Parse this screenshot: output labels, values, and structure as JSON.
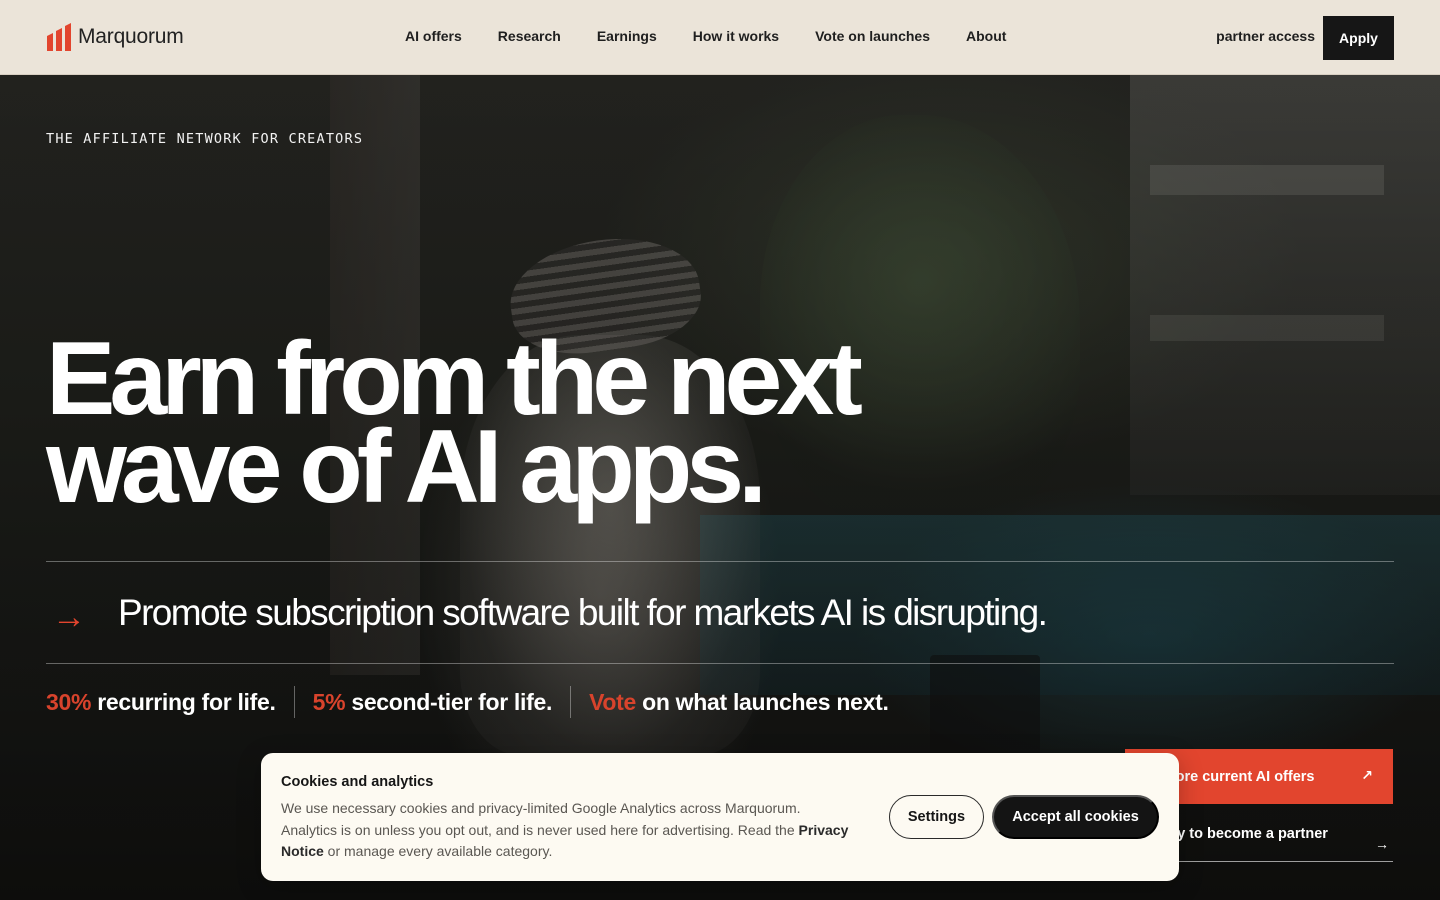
{
  "brand": {
    "name": "Marquorum",
    "accent_color": "#e2452e",
    "logo_icon": "bars-logo-icon"
  },
  "header": {
    "nav": [
      {
        "label": "AI offers"
      },
      {
        "label": "Research"
      },
      {
        "label": "Earnings"
      },
      {
        "label": "How it works"
      },
      {
        "label": "Vote on launches"
      },
      {
        "label": "About"
      }
    ],
    "partner_access": "partner access",
    "apply": "Apply"
  },
  "hero": {
    "eyebrow": "THE AFFILIATE NETWORK FOR CREATORS",
    "headline_line1": "Earn from the next",
    "headline_line2": "wave of AI apps.",
    "tagline_arrow": "→",
    "tagline": "Promote subscription software built for markets AI is disrupting.",
    "stats": [
      {
        "highlight": "30%",
        "text": " recurring for life."
      },
      {
        "highlight": "5%",
        "text": " second-tier for life."
      },
      {
        "highlight": "Vote",
        "text": " on what launches next."
      }
    ],
    "cta_primary": {
      "label": "Explore current AI offers",
      "arrow": "↗"
    },
    "cta_secondary": {
      "label": "Apply to become a partner",
      "arrow": "→"
    }
  },
  "cookie": {
    "title": "Cookies and analytics",
    "body_before": "We use necessary cookies and privacy-limited Google Analytics across Marquorum. Analytics is on unless you opt out, and is never used here for advertising. Read the ",
    "privacy_link": "Privacy Notice",
    "body_after": " or manage every available category.",
    "settings": "Settings",
    "accept": "Accept all cookies"
  }
}
